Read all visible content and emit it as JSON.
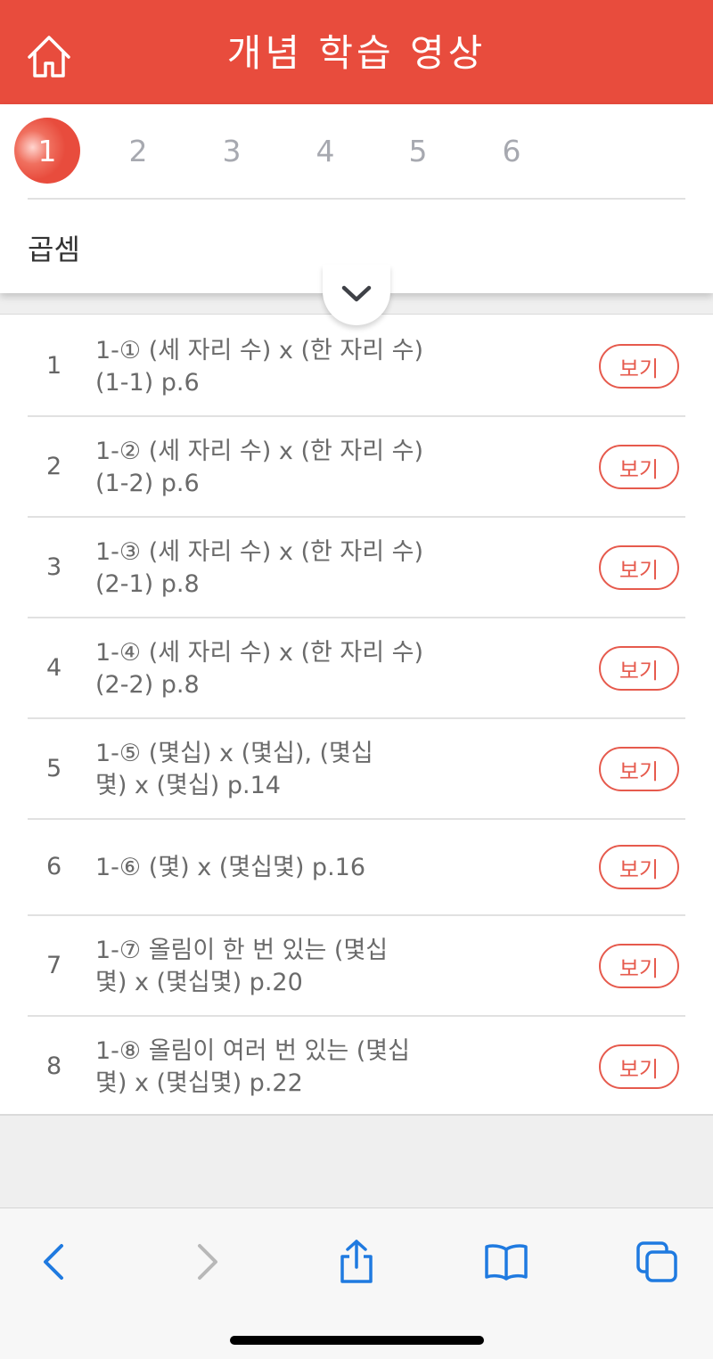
{
  "header": {
    "title": "개념 학습 영상"
  },
  "chapters": {
    "tabs": [
      "1",
      "2",
      "3",
      "4",
      "5",
      "6"
    ],
    "active_index": 0
  },
  "section": {
    "title": "곱셈"
  },
  "list": {
    "items": [
      {
        "num": "1",
        "line1": "1-① (세 자리 수) x (한 자리 수)",
        "line2": "(1-1) p.6",
        "button": "보기"
      },
      {
        "num": "2",
        "line1": "1-② (세 자리 수) x (한 자리 수)",
        "line2": "(1-2) p.6",
        "button": "보기"
      },
      {
        "num": "3",
        "line1": "1-③ (세 자리 수) x (한 자리 수)",
        "line2": "(2-1) p.8",
        "button": "보기"
      },
      {
        "num": "4",
        "line1": "1-④ (세 자리 수) x (한 자리 수)",
        "line2": "(2-2) p.8",
        "button": "보기"
      },
      {
        "num": "5",
        "line1": "1-⑤ (몇십) x (몇십), (몇십",
        "line2": "몇) x (몇십) p.14",
        "button": "보기"
      },
      {
        "num": "6",
        "line1": "1-⑥ (몇) x (몇십몇) p.16",
        "line2": "",
        "button": "보기"
      },
      {
        "num": "7",
        "line1": "1-⑦ 올림이 한 번 있는 (몇십",
        "line2": "몇) x (몇십몇) p.20",
        "button": "보기"
      },
      {
        "num": "8",
        "line1": "1-⑧ 올림이 여러 번 있는 (몇십",
        "line2": "몇) x (몇십몇) p.22",
        "button": "보기"
      }
    ]
  },
  "icons": {
    "home": "home-icon",
    "collapse": "chevron-down-icon",
    "back": "chevron-left-icon",
    "forward": "chevron-right-icon",
    "share": "share-icon",
    "bookmarks": "book-icon",
    "tabs": "tabs-icon"
  },
  "colors": {
    "accent": "#e84c3d",
    "ios_blue": "#1f7ae0",
    "disabled": "#b8b8b8"
  }
}
